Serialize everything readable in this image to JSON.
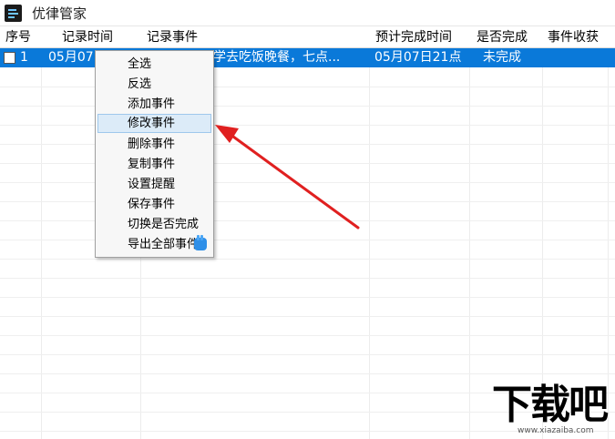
{
  "window": {
    "title": "优律管家"
  },
  "table": {
    "columns": [
      "序号",
      "记录时间",
      "记录事件",
      "预计完成时间",
      "是否完成",
      "事件收获"
    ],
    "rows": [
      {
        "index": "1",
        "record_time": "05月07",
        "event": "学去吃饭晚餐，七点...",
        "expected_time": "05月07日21点",
        "status": "未完成",
        "gain": ""
      }
    ]
  },
  "context_menu": {
    "items": [
      "全选",
      "反选",
      "添加事件",
      "修改事件",
      "删除事件",
      "复制事件",
      "设置提醒",
      "保存事件",
      "切换是否完成",
      "导出全部事件"
    ],
    "highlighted": "修改事件"
  },
  "watermark": {
    "title": "下载吧",
    "url": "www.xiazaiba.com"
  },
  "colors": {
    "selection": "#0a79d9",
    "arrow": "#e02020",
    "menu_highlight": "#dcebf8"
  }
}
